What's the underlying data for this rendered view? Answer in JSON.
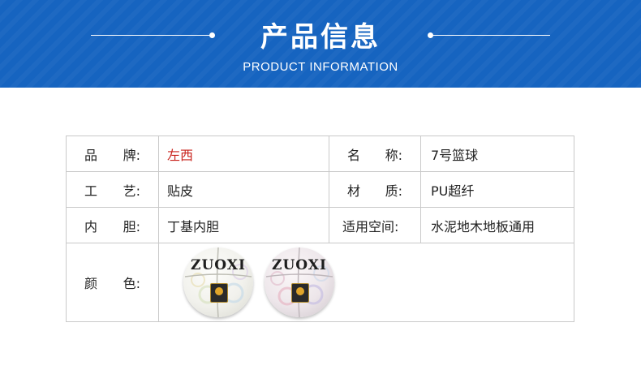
{
  "header": {
    "title": "产品信息",
    "subtitle": "PRODUCT INFORMATION"
  },
  "specs": {
    "brand_label": [
      "品",
      "牌:"
    ],
    "brand_value": "左西",
    "name_label": [
      "名",
      "称:"
    ],
    "name_value": "7号篮球",
    "craft_label": [
      "工",
      "艺:"
    ],
    "craft_value": "贴皮",
    "material_label": [
      "材",
      "质:"
    ],
    "material_value": "PU超纤",
    "bladder_label": [
      "内",
      "胆:"
    ],
    "bladder_value": "丁基内胆",
    "venue_label": "适用空间:",
    "venue_value": "水泥地木地板通用",
    "color_label": [
      "颜",
      "色:"
    ]
  },
  "products": {
    "ball1_logo": "ZUOXI",
    "ball2_logo": "ZUOXI"
  },
  "colors": {
    "banner_blue": "#1664c0",
    "brand_red": "#c8231c",
    "border_gray": "#c9c9c9"
  }
}
